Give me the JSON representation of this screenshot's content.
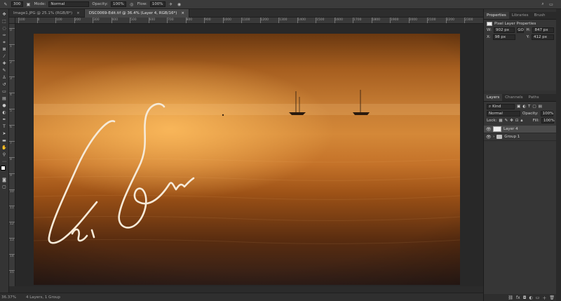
{
  "options_bar": {
    "brush_size": "300",
    "mode_label": "Mode:",
    "mode_value": "Normal",
    "opacity_label": "Opacity:",
    "opacity_value": "100%",
    "flow_label": "Flow:",
    "flow_value": "100%"
  },
  "tabs": [
    {
      "label": "Image1.JPG @ 25.1% (RGB/8*)",
      "active": false
    },
    {
      "label": "DSC0069-Edit.tif @ 36.4% (Layer 4, RGB/16*)",
      "active": true
    }
  ],
  "rulers": {
    "h_labels": [
      "100",
      "0",
      "100",
      "200",
      "300",
      "400",
      "500",
      "600",
      "700",
      "800",
      "900",
      "1000",
      "1100",
      "1200",
      "1300",
      "1400",
      "1500",
      "1600",
      "1700",
      "1800",
      "1900",
      "2000",
      "2100",
      "2200",
      "2300",
      "2400"
    ],
    "v_labels": [
      "0",
      "1",
      "2",
      "3",
      "4",
      "5",
      "6",
      "7",
      "8",
      "9",
      "10",
      "11",
      "12",
      "13",
      "14",
      "15"
    ]
  },
  "status": {
    "zoom": "36.37%",
    "layers_info": "4 Layers, 1 Group"
  },
  "properties": {
    "tabs": [
      "Properties",
      "Libraries",
      "Brush"
    ],
    "section": "Pixel Layer Properties",
    "w_label": "W:",
    "w_value": "902 px",
    "link_icon": "GO",
    "h_label": "H:",
    "h_value": "847 px",
    "x_label": "X:",
    "x_value": "98 px",
    "y_label": "Y:",
    "y_value": "412 px"
  },
  "layers": {
    "tabs": [
      "Layers",
      "Channels",
      "Paths"
    ],
    "filter_label": "Kind",
    "blend_mode": "Normal",
    "opacity_label": "Opacity:",
    "opacity_value": "100%",
    "lock_label": "Lock:",
    "fill_label": "Fill:",
    "fill_value": "100%",
    "items": [
      {
        "name": "Layer 4",
        "type": "layer",
        "selected": true
      },
      {
        "name": "Group 1",
        "type": "group",
        "selected": false
      }
    ]
  },
  "colors": {
    "accent": "#474747",
    "canvas_glow": "#d48838"
  }
}
